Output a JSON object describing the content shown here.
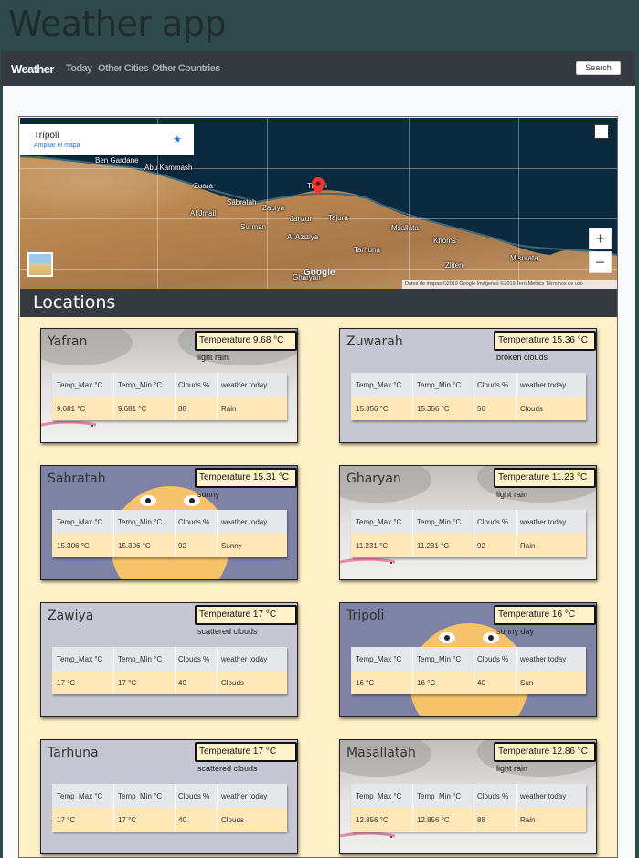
{
  "app_title": "Weather app",
  "navbar": {
    "brand": "Weather",
    "links": [
      "Today",
      "Other Cities",
      "Other Countries"
    ],
    "search_label": "Search"
  },
  "map": {
    "place_name": "Trípoli",
    "enlarge_link": "Ampliar el mapa",
    "zoom_in": "+",
    "zoom_out": "−",
    "footer": "Datos de mapas ©2019 Google Imágenes ©2019 TerraMetrics    Términos de uso",
    "logo_text": "Google",
    "labels": [
      "Ben Gardane",
      "Abu Kammash",
      "Zuara",
      "Sabratah",
      "Zauiya",
      "Trípoli",
      "Tajura",
      "Al Jmail",
      "Surman",
      "Janzur",
      "Al Aziziya",
      "Msallata",
      "Tarhuna",
      "Khoms",
      "Gharyan",
      "Zliten",
      "Misurata"
    ]
  },
  "locations_title": "Locations",
  "table_headers": [
    "Temp_Max °C",
    "Temp_Min °C",
    "Clouds %",
    "weather today"
  ],
  "cards": [
    {
      "city": "Yafran",
      "temperature": "Temperature 9.68 °C",
      "description": "light rain",
      "temp_max": "9.681 °C",
      "temp_min": "9.681 °C",
      "clouds": "88",
      "weather": "Rain",
      "style": "cloudy",
      "rain": true
    },
    {
      "city": "Zuwarah",
      "temperature": "Temperature 15.36 °C",
      "description": "broken clouds",
      "temp_max": "15.356 °C",
      "temp_min": "15.356 °C",
      "clouds": "56",
      "weather": "Clouds",
      "style": "light",
      "rain": false
    },
    {
      "city": "Sabratah",
      "temperature": "Temperature 15.31 °C",
      "description": "sunny",
      "temp_max": "15.306 °C",
      "temp_min": "15.306 °C",
      "clouds": "92",
      "weather": "Sunny",
      "style": "sunny",
      "rain": false
    },
    {
      "city": "Gharyan",
      "temperature": "Temperature 11.23 °C",
      "description": "light rain",
      "temp_max": "11.231 °C",
      "temp_min": "11.231 °C",
      "clouds": "92",
      "weather": "Rain",
      "style": "cloudy",
      "rain": true
    },
    {
      "city": "Zawiya",
      "temperature": "Temperature 17 °C",
      "description": "scattered clouds",
      "temp_max": "17 °C",
      "temp_min": "17 °C",
      "clouds": "40",
      "weather": "Clouds",
      "style": "light",
      "rain": false
    },
    {
      "city": "Tripoli",
      "temperature": "Temperature 16 °C",
      "description": "sunny day",
      "temp_max": "16 °C",
      "temp_min": "16 °C",
      "clouds": "40",
      "weather": "Sun",
      "style": "sunny",
      "rain": false
    },
    {
      "city": "Tarhuna",
      "temperature": "Temperature 17 °C",
      "description": "scattered clouds",
      "temp_max": "17 °C",
      "temp_min": "17 °C",
      "clouds": "40",
      "weather": "Clouds",
      "style": "light",
      "rain": false
    },
    {
      "city": "Masallatah",
      "temperature": "Temperature 12.86 °C",
      "description": "light rain",
      "temp_max": "12.856 °C",
      "temp_min": "12.856 °C",
      "clouds": "88",
      "weather": "Rain",
      "style": "cloudy",
      "rain": true
    }
  ],
  "colors": {
    "page_bg": "#2e4a4a",
    "navbar_bg": "#343a40",
    "panel_bg": "#fff0c8",
    "table_header_bg": "#e5e7ea",
    "table_row_bg": "#ffe7b8",
    "map_link": "#1a73e8"
  }
}
